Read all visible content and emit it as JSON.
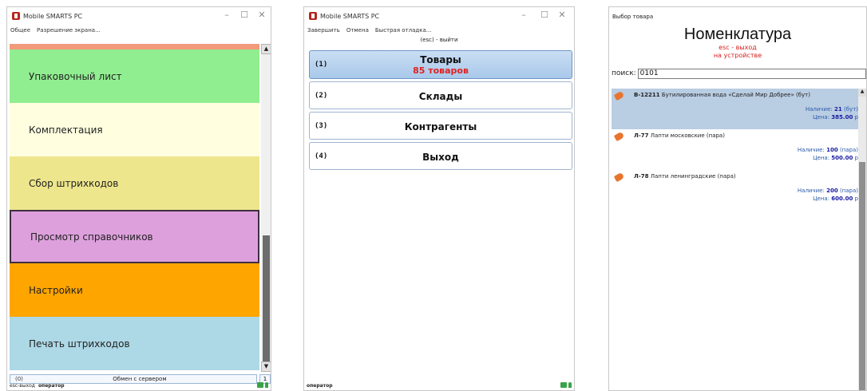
{
  "window1": {
    "title": "Mobile SMARTS PC",
    "menu": [
      "Общее",
      "Разрешение экрана..."
    ],
    "tiles": [
      {
        "label": "Упаковочный лист",
        "color": "#90ee90"
      },
      {
        "label": "Комплектация",
        "color": "#ffffe0"
      },
      {
        "label": "Сбор штрихкодов",
        "color": "#eee68c"
      },
      {
        "label": "Просмотр справочников",
        "color": "#dda0dd"
      },
      {
        "label": "Настройки",
        "color": "#ffa500"
      },
      {
        "label": "Печать штрихкодов",
        "color": "#add8e6"
      }
    ],
    "bottom_num": "(0)",
    "bottom_text": "Обмен с сервером",
    "bottom_count": "1",
    "status_prefix": "esc-выход",
    "status_user": "оператор"
  },
  "window2": {
    "title": "Mobile SMARTS PC",
    "menu": [
      "Завершить",
      "Отмена",
      "Быстрая отладка..."
    ],
    "hint": "(esc) - выйти",
    "buttons": [
      {
        "num": "(1)",
        "label": "Товары",
        "sub": "85 товаров"
      },
      {
        "num": "(2)",
        "label": "Склады"
      },
      {
        "num": "(3)",
        "label": "Контрагенты"
      },
      {
        "num": "(4)",
        "label": "Выход"
      }
    ],
    "status_user": "оператор"
  },
  "window3": {
    "title": "Выбор товара",
    "heading": "Номенклатура",
    "esc_line1": "esc - выход",
    "esc_line2": "на устройстве",
    "search_label": "поиск:",
    "search_value": "0101",
    "items": [
      {
        "code": "В-12211",
        "name": "Бутилированная вода «Сделай Мир Добрее» (бут)",
        "avail_label": "Наличие:",
        "avail_value": "21",
        "avail_unit": "(бут)",
        "price_label": "Цена:",
        "price_value": "385.00",
        "price_unit": "р"
      },
      {
        "code": "Л-77",
        "name": "Лапти московские (пара)",
        "avail_label": "Наличие:",
        "avail_value": "100",
        "avail_unit": "(пара)",
        "price_label": "Цена:",
        "price_value": "500.00",
        "price_unit": "р"
      },
      {
        "code": "Л-78",
        "name": "Лапти ленинградские (пара)",
        "avail_label": "Наличие:",
        "avail_value": "200",
        "avail_unit": "(пара)",
        "price_label": "Цена:",
        "price_value": "600.00",
        "price_unit": "р"
      }
    ]
  }
}
